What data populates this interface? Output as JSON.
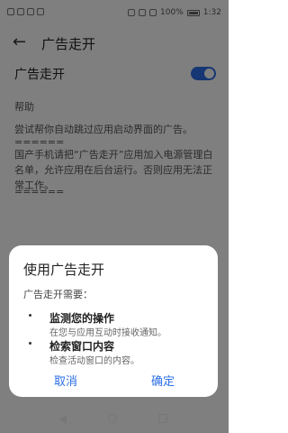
{
  "status": {
    "battery": "100%",
    "time": "1:32"
  },
  "header": {
    "title": "广告走开"
  },
  "settings": {
    "toggle_label": "广告走开",
    "toggle_on": true,
    "help_title": "帮助",
    "help_text": "尝试帮你自动跳过应用启动界面的广告。",
    "separator": "======",
    "notice": "国产手机请把“广告走开”应用加入电源管理白名单，允许应用在后台运行。否则应用无法正常工作。"
  },
  "dialog": {
    "title": "使用广告走开",
    "subtitle": "广告走开需要：",
    "permissions": [
      {
        "title": "监测您的操作",
        "desc": "在您与应用互动时接收通知。"
      },
      {
        "title": "检索窗口内容",
        "desc": "检查活动窗口的内容。"
      }
    ],
    "cancel": "取消",
    "ok": "确定"
  },
  "colors": {
    "accent": "#2c6fe6"
  }
}
